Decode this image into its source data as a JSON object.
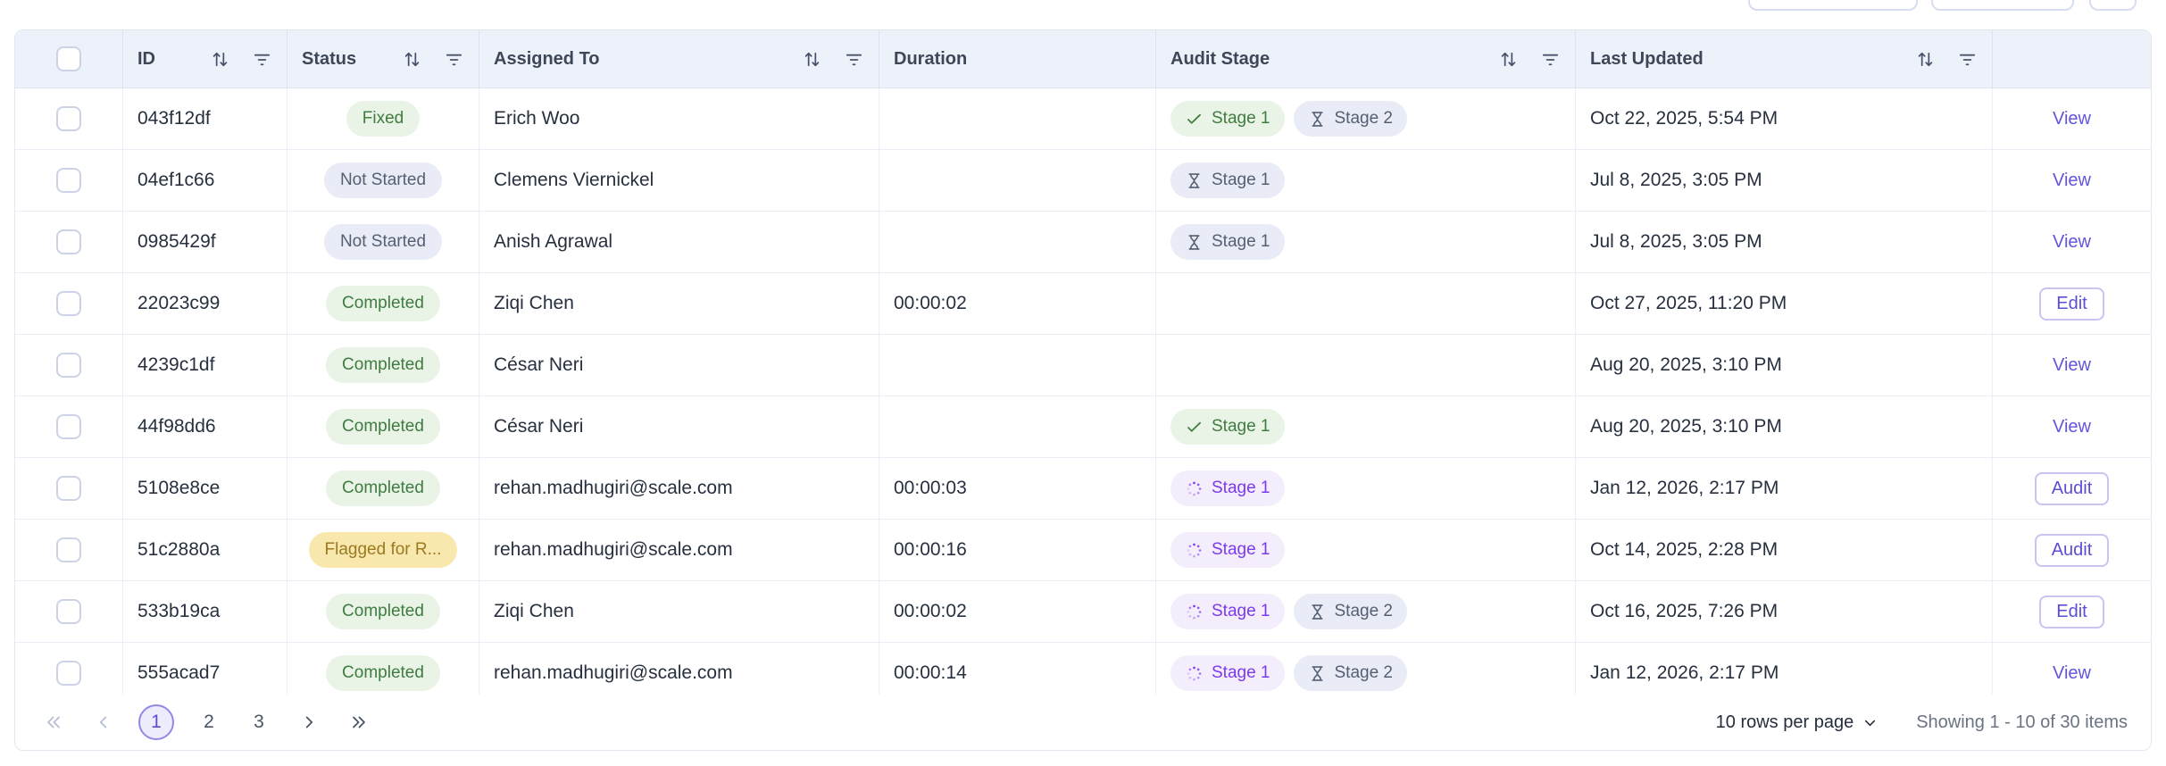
{
  "toolbar": {
    "partial_buttons": [
      "",
      "",
      ""
    ]
  },
  "icons": {
    "sort": "sort-arrows-icon",
    "filter": "filter-lines-icon",
    "stage_done": "check-icon",
    "stage_pending": "hourglass-icon",
    "stage_progress": "spinner-dots-icon",
    "rows_per_page": "chevron-down-icon",
    "pager": [
      "double-chevron-left-icon",
      "chevron-left-icon",
      "chevron-right-icon",
      "double-chevron-right-icon"
    ]
  },
  "colors": {
    "accent_purple": "#5b4ed6",
    "header_bg": "#edf1fa",
    "badge_green_bg": "#e9f3e6",
    "badge_green_text": "#3f7c41",
    "badge_gray_bg": "#e9ecf6",
    "badge_gray_text": "#555f73",
    "badge_yellow_bg": "#f8e8ae",
    "badge_yellow_text": "#9a7a1f",
    "badge_purple_bg": "#f4edfc",
    "badge_purple_text": "#7b3aec"
  },
  "table": {
    "columns": [
      {
        "key": "select",
        "label": "",
        "sortable": false,
        "filterable": false
      },
      {
        "key": "id",
        "label": "ID",
        "sortable": true,
        "filterable": true
      },
      {
        "key": "status",
        "label": "Status",
        "sortable": true,
        "filterable": true
      },
      {
        "key": "assigned_to",
        "label": "Assigned To",
        "sortable": true,
        "filterable": true
      },
      {
        "key": "duration",
        "label": "Duration",
        "sortable": false,
        "filterable": false
      },
      {
        "key": "audit_stage",
        "label": "Audit Stage",
        "sortable": true,
        "filterable": true
      },
      {
        "key": "last_updated",
        "label": "Last Updated",
        "sortable": true,
        "filterable": true
      },
      {
        "key": "actions",
        "label": "",
        "sortable": false,
        "filterable": false
      }
    ],
    "rows": [
      {
        "id": "043f12df",
        "status": "Fixed",
        "status_variant": "green",
        "assigned_to": "Erich Woo",
        "duration": "",
        "stages": [
          {
            "label": "Stage 1",
            "state": "done"
          },
          {
            "label": "Stage 2",
            "state": "pending"
          }
        ],
        "last_updated": "Oct 22, 2025, 5:54 PM",
        "action": "View",
        "action_style": "link"
      },
      {
        "id": "04ef1c66",
        "status": "Not Started",
        "status_variant": "gray",
        "assigned_to": "Clemens Viernickel",
        "duration": "",
        "stages": [
          {
            "label": "Stage 1",
            "state": "pending"
          }
        ],
        "last_updated": "Jul 8, 2025, 3:05 PM",
        "action": "View",
        "action_style": "link"
      },
      {
        "id": "0985429f",
        "status": "Not Started",
        "status_variant": "gray",
        "assigned_to": "Anish Agrawal",
        "duration": "",
        "stages": [
          {
            "label": "Stage 1",
            "state": "pending"
          }
        ],
        "last_updated": "Jul 8, 2025, 3:05 PM",
        "action": "View",
        "action_style": "link"
      },
      {
        "id": "22023c99",
        "status": "Completed",
        "status_variant": "green",
        "assigned_to": "Ziqi Chen",
        "duration": "00:00:02",
        "stages": [],
        "last_updated": "Oct 27, 2025, 11:20 PM",
        "action": "Edit",
        "action_style": "button"
      },
      {
        "id": "4239c1df",
        "status": "Completed",
        "status_variant": "green",
        "assigned_to": "César Neri",
        "duration": "",
        "stages": [],
        "last_updated": "Aug 20, 2025, 3:10 PM",
        "action": "View",
        "action_style": "link"
      },
      {
        "id": "44f98dd6",
        "status": "Completed",
        "status_variant": "green",
        "assigned_to": "César Neri",
        "duration": "",
        "stages": [
          {
            "label": "Stage 1",
            "state": "done"
          }
        ],
        "last_updated": "Aug 20, 2025, 3:10 PM",
        "action": "View",
        "action_style": "link"
      },
      {
        "id": "5108e8ce",
        "status": "Completed",
        "status_variant": "green",
        "assigned_to": "rehan.madhugiri@scale.com",
        "duration": "00:00:03",
        "stages": [
          {
            "label": "Stage 1",
            "state": "progress"
          }
        ],
        "last_updated": "Jan 12, 2026, 2:17 PM",
        "action": "Audit",
        "action_style": "button"
      },
      {
        "id": "51c2880a",
        "status": "Flagged for R...",
        "status_variant": "yellow",
        "assigned_to": "rehan.madhugiri@scale.com",
        "duration": "00:00:16",
        "stages": [
          {
            "label": "Stage 1",
            "state": "progress"
          }
        ],
        "last_updated": "Oct 14, 2025, 2:28 PM",
        "action": "Audit",
        "action_style": "button"
      },
      {
        "id": "533b19ca",
        "status": "Completed",
        "status_variant": "green",
        "assigned_to": "Ziqi Chen",
        "duration": "00:00:02",
        "stages": [
          {
            "label": "Stage 1",
            "state": "progress"
          },
          {
            "label": "Stage 2",
            "state": "pending"
          }
        ],
        "last_updated": "Oct 16, 2025, 7:26 PM",
        "action": "Edit",
        "action_style": "button"
      },
      {
        "id": "555acad7",
        "status": "Completed",
        "status_variant": "green",
        "assigned_to": "rehan.madhugiri@scale.com",
        "duration": "00:00:14",
        "stages": [
          {
            "label": "Stage 1",
            "state": "progress"
          },
          {
            "label": "Stage 2",
            "state": "pending"
          }
        ],
        "last_updated": "Jan 12, 2026, 2:17 PM",
        "action": "View",
        "action_style": "link"
      }
    ]
  },
  "pagination": {
    "current_page": "1",
    "page_2": "2",
    "page_3": "3",
    "rows_per_page_label": "10 rows per page",
    "summary": "Showing 1 - 10 of 30 items"
  }
}
